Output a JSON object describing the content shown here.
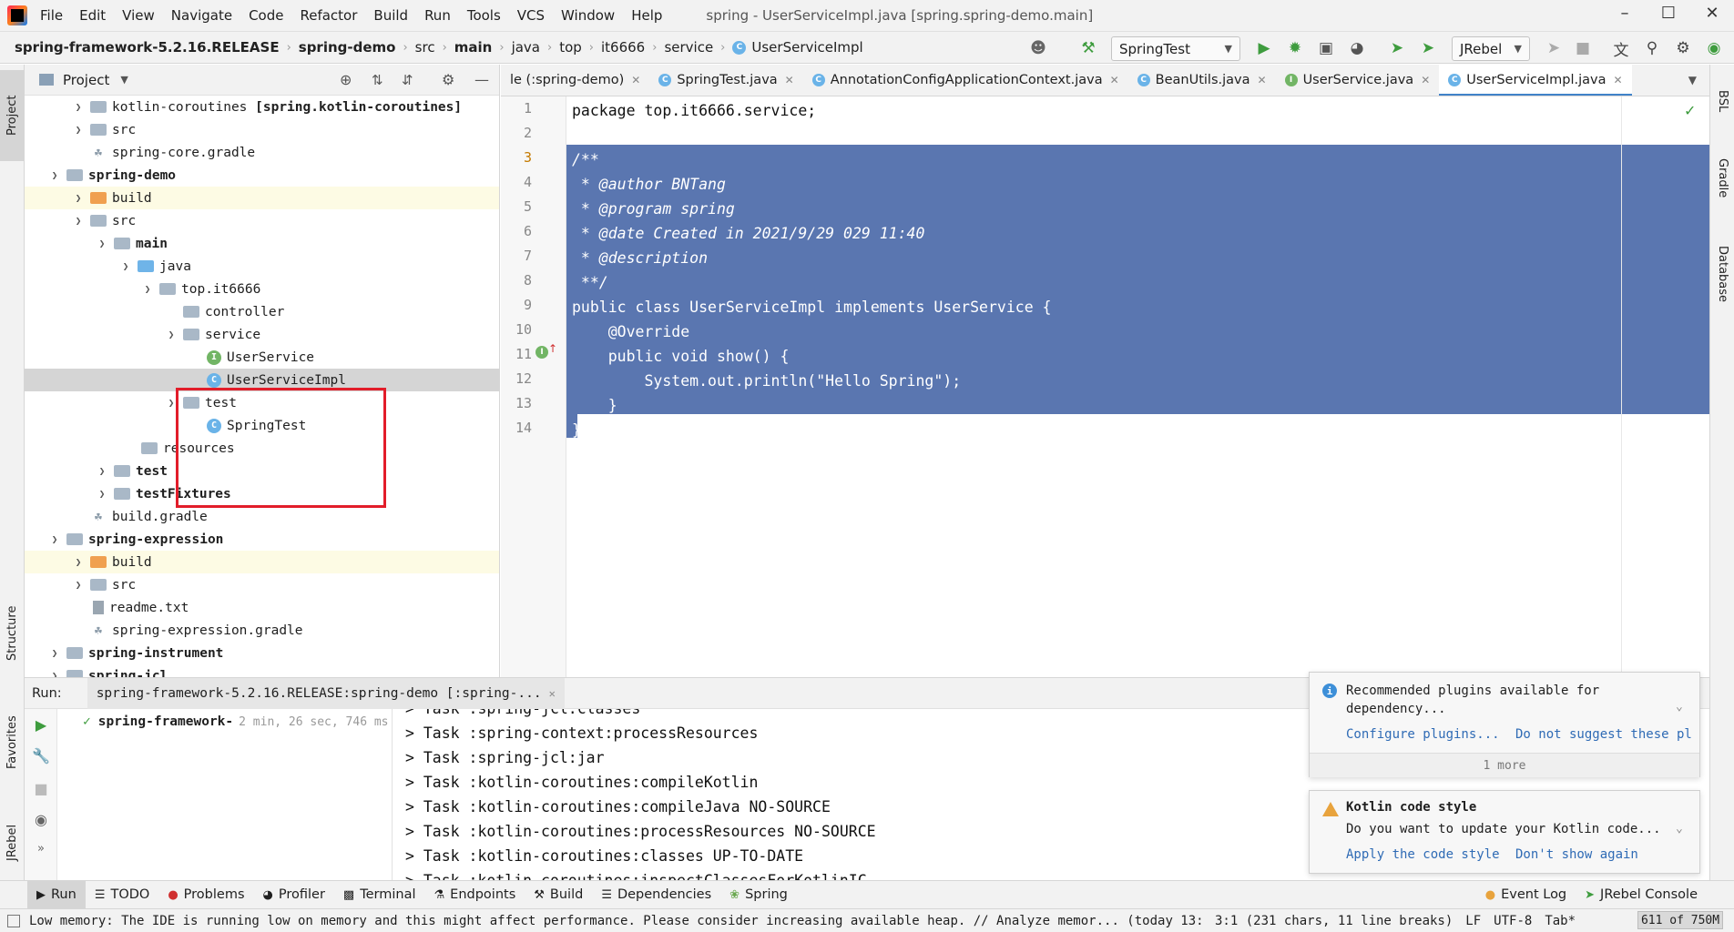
{
  "menu": {
    "items": [
      "File",
      "Edit",
      "View",
      "Navigate",
      "Code",
      "Refactor",
      "Build",
      "Run",
      "Tools",
      "VCS",
      "Window",
      "Help"
    ],
    "window_title": "spring - UserServiceImpl.java [spring.spring-demo.main]"
  },
  "breadcrumbs": [
    "spring-framework-5.2.16.RELEASE",
    "spring-demo",
    "src",
    "main",
    "java",
    "top",
    "it6666",
    "service",
    "UserServiceImpl"
  ],
  "toolbar": {
    "run_config": "SpringTest",
    "jrebel": "JRebel"
  },
  "left_strip": {
    "project": "Project",
    "structure": "Structure",
    "favorites": "Favorites",
    "jrebel": "JRebel"
  },
  "right_strip": {
    "bsl": "BSL",
    "gradle": "Gradle",
    "database": "Database"
  },
  "project_panel": {
    "title": "Project",
    "tree": [
      {
        "label": "kotlin-coroutines",
        "suffix": "[spring.kotlin-coroutines]"
      },
      {
        "label": "src"
      },
      {
        "label": "spring-core.gradle"
      },
      {
        "label": "spring-demo"
      },
      {
        "label": "build"
      },
      {
        "label": "src"
      },
      {
        "label": "main"
      },
      {
        "label": "java"
      },
      {
        "label": "top.it6666"
      },
      {
        "label": "controller"
      },
      {
        "label": "service"
      },
      {
        "label": "UserService"
      },
      {
        "label": "UserServiceImpl"
      },
      {
        "label": "test"
      },
      {
        "label": "SpringTest"
      },
      {
        "label": "resources"
      },
      {
        "label": "test"
      },
      {
        "label": "testFixtures"
      },
      {
        "label": "build.gradle"
      },
      {
        "label": "spring-expression"
      },
      {
        "label": "build"
      },
      {
        "label": "src"
      },
      {
        "label": "readme.txt"
      },
      {
        "label": "spring-expression.gradle"
      },
      {
        "label": "spring-instrument"
      },
      {
        "label": "spring-jcl"
      }
    ]
  },
  "editor_tabs": [
    {
      "label": "le (:spring-demo)",
      "icon": "none"
    },
    {
      "label": "SpringTest.java",
      "icon": "C"
    },
    {
      "label": "AnnotationConfigApplicationContext.java",
      "icon": "C"
    },
    {
      "label": "BeanUtils.java",
      "icon": "C"
    },
    {
      "label": "UserService.java",
      "icon": "I"
    },
    {
      "label": "UserServiceImpl.java",
      "icon": "C"
    }
  ],
  "code": {
    "line_numbers": [
      "1",
      "2",
      "3",
      "4",
      "5",
      "6",
      "7",
      "8",
      "9",
      "10",
      "11",
      "12",
      "13",
      "14"
    ],
    "lines": [
      "package top.it6666.service;",
      "",
      "/**",
      " * @author BNTang",
      " * @program spring",
      " * @date Created in 2021/9/29 029 11:40",
      " * @description",
      " **/",
      "public class UserServiceImpl implements UserService {",
      "    @Override",
      "    public void show() {",
      "        System.out.println(\"Hello Spring\");",
      "    }",
      "}"
    ]
  },
  "run_panel": {
    "label": "Run:",
    "config_tab": "spring-framework-5.2.16.RELEASE:spring-demo [:spring-...",
    "tree_item": "spring-framework-",
    "tree_time": "2 min, 26 sec, 746 ms",
    "console": [
      "> Task :spring-jcl:classes",
      "> Task :spring-context:processResources",
      "> Task :spring-jcl:jar",
      "> Task :kotlin-coroutines:compileKotlin",
      "> Task :kotlin-coroutines:compileJava NO-SOURCE",
      "> Task :kotlin-coroutines:processResources NO-SOURCE",
      "> Task :kotlin-coroutines:classes UP-TO-DATE",
      "> Task :kotlin-coroutines:inspectClassesForKotlinIC"
    ]
  },
  "notifications": {
    "plugins": {
      "title": "Recommended plugins available for dependency...",
      "link1": "Configure plugins...",
      "link2": "Do not suggest these pl",
      "more": "1 more"
    },
    "kotlin": {
      "title": "Kotlin code style",
      "body": "Do you want to update your Kotlin code...",
      "link1": "Apply the code style",
      "link2": "Don't show again"
    }
  },
  "bottom_bar": {
    "run": "Run",
    "todo": "TODO",
    "problems": "Problems",
    "profiler": "Profiler",
    "terminal": "Terminal",
    "endpoints": "Endpoints",
    "build": "Build",
    "dependencies": "Dependencies",
    "spring": "Spring",
    "event_log": "Event Log",
    "jrebel_console": "JRebel Console"
  },
  "status_bar": {
    "message": "Low memory: The IDE is running low on memory and this might affect performance. Please consider increasing available heap. // Analyze memor... (today 13:20)",
    "position": "3:1 (231 chars, 11 line breaks)",
    "line_sep": "LF",
    "encoding": "UTF-8",
    "indent": "Tab*",
    "memory": "611 of 750M"
  },
  "colors": {
    "selection": "#5a76b0",
    "accent": "#4083c9",
    "highlight_box": "#e21d2a"
  }
}
